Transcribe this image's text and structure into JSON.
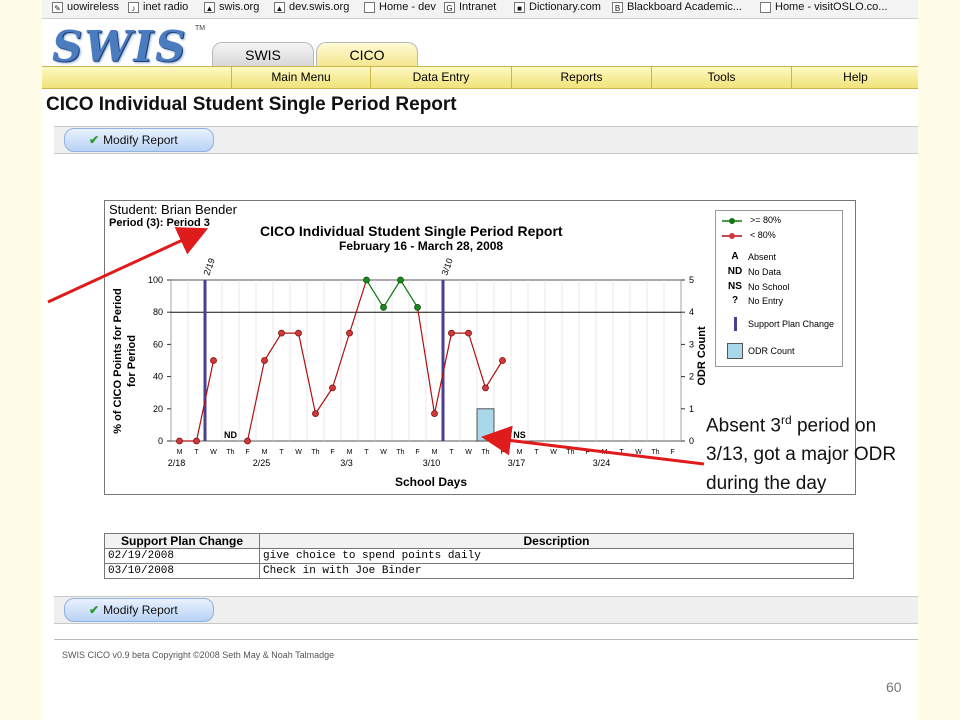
{
  "bookmarks": [
    {
      "label": "uowireless",
      "icon": "bookmark-icon"
    },
    {
      "label": "inet radio",
      "icon": "radio-icon"
    },
    {
      "label": "swis.org",
      "icon": "tree-icon"
    },
    {
      "label": "dev.swis.org",
      "icon": "tree-icon"
    },
    {
      "label": "Home - dev",
      "icon": "page-icon"
    },
    {
      "label": "Intranet",
      "icon": "google-icon"
    },
    {
      "label": "Dictionary.com",
      "icon": "book-icon"
    },
    {
      "label": "Blackboard Academic...",
      "icon": "bb-icon"
    },
    {
      "label": "Home - visitOSLO.co...",
      "icon": "page-icon"
    }
  ],
  "logo": {
    "text": "SWIS",
    "trademark": "TM"
  },
  "tabs": {
    "swis": "SWIS",
    "cico": "CICO"
  },
  "menu": [
    "Main Menu",
    "Data Entry",
    "Reports",
    "Tools",
    "Help"
  ],
  "page_title": "CICO Individual Student Single Period Report",
  "modify_label": "Modify Report",
  "chart_header": {
    "student": "Student: Brian Bender",
    "period": "Period (3): Period 3"
  },
  "chart_data": {
    "type": "line",
    "title": "CICO Individual Student Single Period Report",
    "subtitle": "February 16 - March 28, 2008",
    "xlabel": "School Days",
    "ylabel": "% of CICO Points for Period",
    "ylabel_right": "ODR Count",
    "ylim": [
      0,
      100
    ],
    "ylim_right": [
      0,
      5
    ],
    "yticks": [
      0,
      20,
      40,
      60,
      80,
      100
    ],
    "yticks_right": [
      0,
      1,
      2,
      3,
      4,
      5
    ],
    "threshold": 80,
    "day_labels": [
      "M",
      "T",
      "W",
      "Th",
      "F",
      "M",
      "T",
      "W",
      "Th",
      "F",
      "M",
      "T",
      "W",
      "Th",
      "F",
      "M",
      "T",
      "W",
      "Th",
      "F",
      "M",
      "T",
      "W",
      "Th",
      "F",
      "M",
      "T",
      "W",
      "Th",
      "F"
    ],
    "week_labels": [
      {
        "index": 0,
        "label": "2/18"
      },
      {
        "index": 5,
        "label": "2/25"
      },
      {
        "index": 10,
        "label": "3/3"
      },
      {
        "index": 15,
        "label": "3/10"
      },
      {
        "index": 20,
        "label": "3/17"
      },
      {
        "index": 25,
        "label": "3/24"
      }
    ],
    "values": [
      0,
      0,
      50,
      null,
      0,
      50,
      67,
      67,
      17,
      33,
      67,
      100,
      83,
      100,
      83,
      17,
      67,
      67,
      33,
      50
    ],
    "markers": [
      {
        "index": 3,
        "label": "ND"
      },
      {
        "index": 20,
        "label": "NS"
      }
    ],
    "plan_changes": [
      {
        "index": 1.5,
        "label": "2/19"
      },
      {
        "index": 15.5,
        "label": "3/10"
      }
    ],
    "odr": [
      {
        "index": 18,
        "value": 1
      }
    ],
    "colors": {
      "above": "#117711",
      "below": "#b01010",
      "plan": "#4b3f8f",
      "odr": "#a8d8ea"
    }
  },
  "legend": {
    "above": ">= 80%",
    "below": "< 80%",
    "items": [
      {
        "key": "A",
        "label": "Absent"
      },
      {
        "key": "ND",
        "label": "No Data"
      },
      {
        "key": "NS",
        "label": "No School"
      },
      {
        "key": "?",
        "label": "No Entry"
      }
    ],
    "plan": "Support Plan Change",
    "odr": "ODR Count"
  },
  "support_plan": {
    "headers": [
      "Support Plan Change",
      "Description"
    ],
    "rows": [
      [
        "02/19/2008",
        "give choice to spend points daily"
      ],
      [
        "03/10/2008",
        "Check in with Joe Binder"
      ]
    ]
  },
  "copyright": "SWIS CICO v0.9 beta Copyright ©2008 Seth May & Noah Talmadge",
  "page_number": "60",
  "annotation": {
    "line1_pre": "Absent 3",
    "line1_sup": "rd",
    "line1_post": " period on",
    "line2": "3/13, got a major ODR",
    "line3": "during the day"
  }
}
